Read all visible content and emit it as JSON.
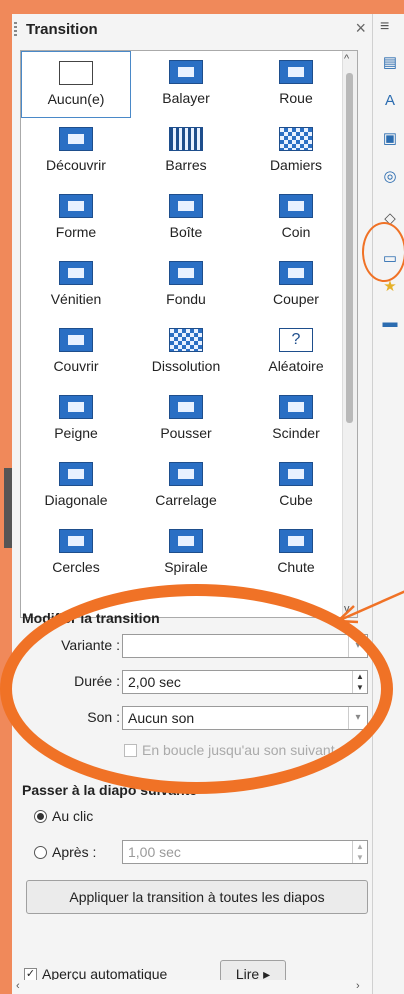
{
  "panel": {
    "title": "Transition",
    "close_glyph": "×"
  },
  "transitions": [
    {
      "label": "Aucun(e)",
      "selected": true,
      "icon": "blank-icon"
    },
    {
      "label": "Balayer",
      "icon": "wipe-icon"
    },
    {
      "label": "Roue",
      "icon": "wheel-icon"
    },
    {
      "label": "Découvrir",
      "icon": "uncover-icon"
    },
    {
      "label": "Barres",
      "icon": "bars-icon"
    },
    {
      "label": "Damiers",
      "icon": "checkers-icon"
    },
    {
      "label": "Forme",
      "icon": "shape-icon"
    },
    {
      "label": "Boîte",
      "icon": "box-icon"
    },
    {
      "label": "Coin",
      "icon": "corner-icon"
    },
    {
      "label": "Vénitien",
      "icon": "venetian-icon"
    },
    {
      "label": "Fondu",
      "icon": "fade-icon"
    },
    {
      "label": "Couper",
      "icon": "cut-icon"
    },
    {
      "label": "Couvrir",
      "icon": "cover-icon"
    },
    {
      "label": "Dissolution",
      "icon": "dissolve-icon"
    },
    {
      "label": "Aléatoire",
      "icon": "random-icon"
    },
    {
      "label": "Peigne",
      "icon": "comb-icon"
    },
    {
      "label": "Pousser",
      "icon": "push-icon"
    },
    {
      "label": "Scinder",
      "icon": "split-icon"
    },
    {
      "label": "Diagonale",
      "icon": "diagonal-icon"
    },
    {
      "label": "Carrelage",
      "icon": "tiles-icon"
    },
    {
      "label": "Cube",
      "icon": "cube-icon"
    },
    {
      "label": "Cercles",
      "icon": "circles-icon"
    },
    {
      "label": "Spirale",
      "icon": "spiral-icon"
    },
    {
      "label": "Chute",
      "icon": "fall-icon"
    }
  ],
  "modify": {
    "heading": "Modifier la transition",
    "variant_label": "Variante :",
    "variant_value": "",
    "duration_label": "Durée :",
    "duration_value": "2,00 sec",
    "sound_label": "Son :",
    "sound_value": "Aucun son",
    "loop_label": "En boucle jusqu'au son suivant"
  },
  "advance": {
    "heading": "Passer à la diapo suivante",
    "on_click_label": "Au clic",
    "after_label": "Après :",
    "after_value": "1,00 sec"
  },
  "apply_all_label": "Appliquer la transition à toutes les diapos",
  "footer": {
    "autopreview_label": "Aperçu automatique",
    "play_label": "Lire"
  },
  "sidebar_tabs": [
    "properties-icon",
    "styles-icon",
    "gallery-icon",
    "navigator-icon",
    "shapes-icon",
    "slide-transition-icon",
    "animation-icon",
    "master-slides-icon"
  ],
  "colors": {
    "accent": "#f07226",
    "icon_blue": "#2a6fc4"
  }
}
